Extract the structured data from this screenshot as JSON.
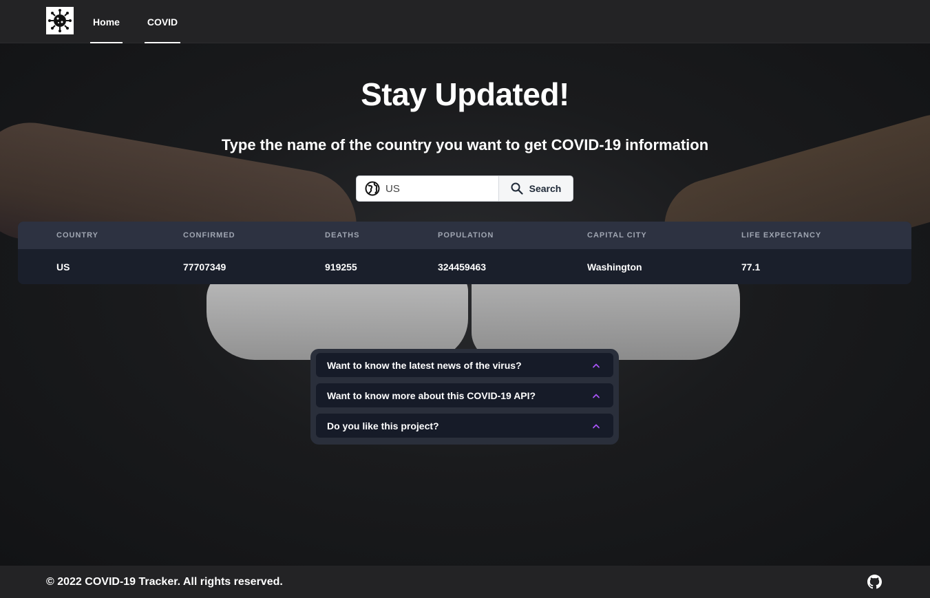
{
  "nav": {
    "logo_icon": "virus-icon",
    "links": [
      {
        "label": "Home"
      },
      {
        "label": "COVID"
      }
    ]
  },
  "hero": {
    "title": "Stay Updated!",
    "subtitle": "Type the name of the country you want to get COVID-19 information"
  },
  "search": {
    "value": "US",
    "placeholder": "US",
    "button_label": "Search",
    "input_icon": "globe-icon",
    "button_icon": "search-icon"
  },
  "table": {
    "headers": [
      "COUNTRY",
      "CONFIRMED",
      "DEATHS",
      "POPULATION",
      "CAPITAL CITY",
      "LIFE EXPECTANCY"
    ],
    "rows": [
      [
        "US",
        "77707349",
        "919255",
        "324459463",
        "Washington",
        "77.1"
      ]
    ]
  },
  "accordion": {
    "items": [
      {
        "label": "Want to know the latest news of the virus?"
      },
      {
        "label": "Want to know more about this COVID-19 API?"
      },
      {
        "label": "Do you like this project?"
      }
    ],
    "chevron_color": "#a855f7"
  },
  "footer": {
    "text": "© 2022 COVID-19 Tracker. All rights reserved.",
    "icon": "github-icon"
  }
}
